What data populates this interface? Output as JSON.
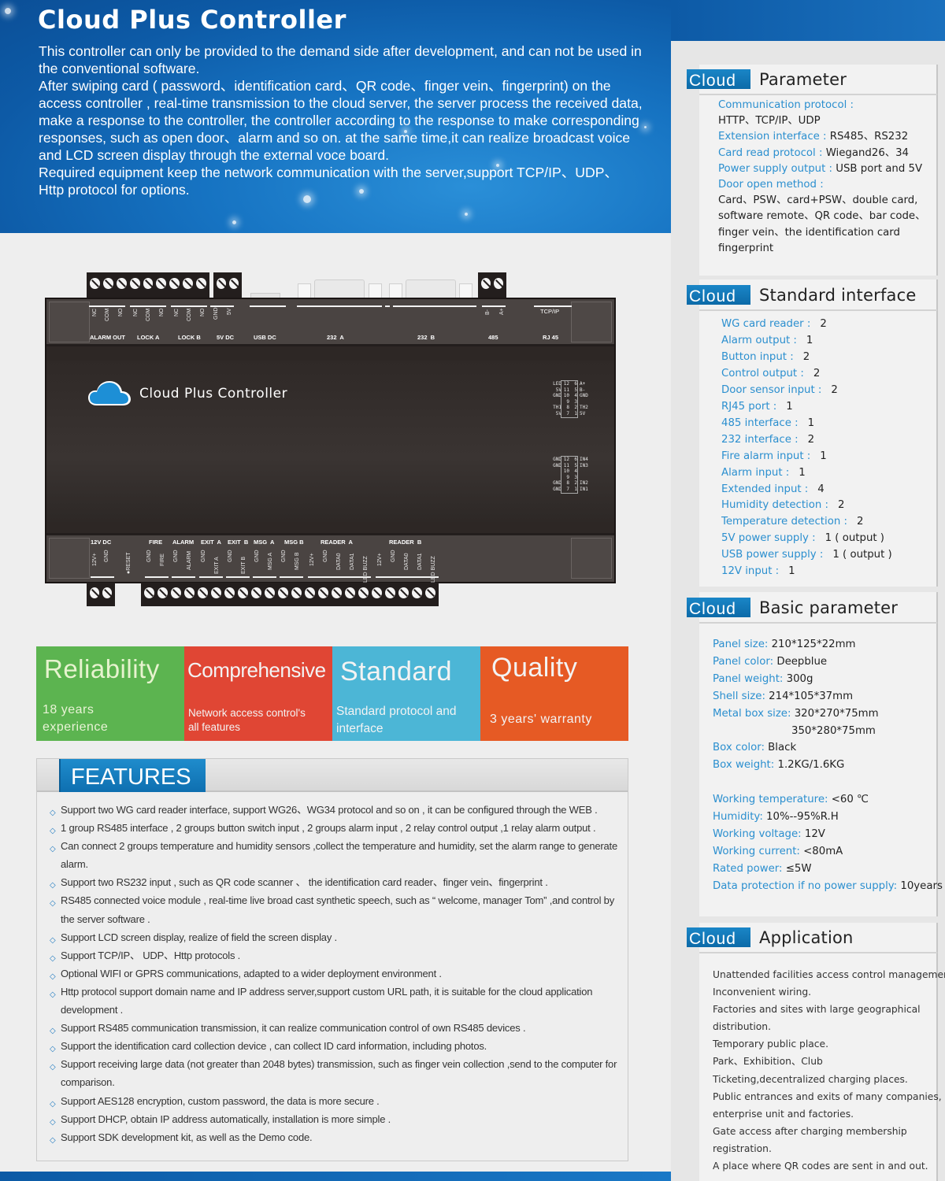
{
  "hero": {
    "title": "Cloud Plus Controller",
    "paragraphs": [
      "This controller can only be provided to the demand side after development, and can not be used in the conventional software.",
      "After swiping card ( password、identification card、QR code、finger vein、fingerprint) on  the  access controller , real-time transmission to the cloud server, the server process the received data,  make a response to the controller, the controller according to the response to make corresponding responses, such as open door、alarm and so on.  at the same time,it can realize broadcast voice and  LCD screen display through the external voce board.",
      "Required equipment  keep the network communication with the server,support  TCP/IP、UDP、 Http protocol for options."
    ]
  },
  "device": {
    "brand": "Cloud Plus Controller",
    "top_groups": [
      {
        "name": "ALARM OUT",
        "pins": [
          "NC",
          "COM",
          "NO"
        ]
      },
      {
        "name": "LOCK A",
        "pins": [
          "NC",
          "COM",
          "NO"
        ]
      },
      {
        "name": "LOCK B",
        "pins": [
          "NC",
          "COM",
          "NO"
        ]
      },
      {
        "name": "5V DC",
        "pins": [
          "GND",
          "5V"
        ]
      },
      {
        "name": "USB DC",
        "pins": []
      },
      {
        "name": "232  A",
        "pins": []
      },
      {
        "name": "232  B",
        "pins": []
      },
      {
        "name": "485",
        "pins": [
          "B-",
          "A+"
        ]
      },
      {
        "name": "RJ 45",
        "pins": [
          "TCP/IP"
        ]
      }
    ],
    "bottom_groups": [
      {
        "name": "12V DC",
        "pins": [
          "12V+",
          "GND"
        ]
      },
      {
        "name": "",
        "pins": [
          "●RESET"
        ]
      },
      {
        "name": "FIRE",
        "pins": [
          "GND",
          "FIRE"
        ]
      },
      {
        "name": "ALARM",
        "pins": [
          "GND",
          "ALARM"
        ]
      },
      {
        "name": "EXIT  A",
        "pins": [
          "GND",
          "EXIT A"
        ]
      },
      {
        "name": "EXIT  B",
        "pins": [
          "GND",
          "EXIT B"
        ]
      },
      {
        "name": "MSG  A",
        "pins": [
          "GND",
          "MSG A"
        ]
      },
      {
        "name": "MSG B",
        "pins": [
          "GND",
          "MSG B"
        ]
      },
      {
        "name": "READER  A",
        "pins": [
          "12V+",
          "GND",
          "DATA0",
          "DATA1",
          "LED BUZZ"
        ]
      },
      {
        "name": "READER  B",
        "pins": [
          "12V+",
          "GND",
          "DATA0",
          "DATA1",
          "LED BUZZ"
        ]
      }
    ],
    "pin_header_1": [
      [
        "LED",
        "12",
        "6",
        "A+"
      ],
      [
        "5V",
        "11",
        "5",
        "B-"
      ],
      [
        "GND",
        "10",
        "4",
        "GND"
      ],
      [
        "",
        "9",
        "3",
        ""
      ],
      [
        "TH1",
        "8",
        "2",
        "TH2"
      ],
      [
        "5V",
        "7",
        "1",
        "5V"
      ]
    ],
    "pin_header_2": [
      [
        "GND",
        "12",
        "6",
        "IN4"
      ],
      [
        "GND",
        "11",
        "5",
        "IN3"
      ],
      [
        "",
        "10",
        "4",
        ""
      ],
      [
        "",
        "9",
        "3",
        ""
      ],
      [
        "GND",
        "8",
        "2",
        "IN2"
      ],
      [
        "GND",
        "7",
        "1",
        "IN1"
      ]
    ]
  },
  "tiles": [
    {
      "title": "Reliability",
      "sub": [
        "18 years",
        "experience"
      ],
      "color": "#5cb450"
    },
    {
      "title": "Comprehensive",
      "sub": [
        "Network access control's",
        "all features"
      ],
      "color": "#e04634"
    },
    {
      "title": "Standard",
      "sub": [
        "Standard protocol and",
        "interface"
      ],
      "color": "#4cb6d6"
    },
    {
      "title": "Quality",
      "sub": [
        "3 years' warranty"
      ],
      "color": "#e65a24"
    }
  ],
  "features": {
    "title": "FEATURES",
    "items": [
      "Support two WG card reader interface, support WG26、WG34 protocol and so on , it can be configured through the WEB .",
      "1 group RS485 interface , 2 groups button switch input , 2 groups alarm input , 2  relay control output ,1  relay alarm output .",
      "Can  connect 2 groups temperature and humidity sensors ,collect the temperature and humidity, set the alarm range to generate alarm.",
      "Support two RS232 input , such as QR code scanner 、 the identification card  reader、finger vein、fingerprint .",
      "RS485 connected voice module , real-time live broad cast synthetic speech, such as “ welcome, manager Tom” ,and control by the server  software .",
      "Support  LCD screen display, realize of field the screen display .",
      "Support  TCP/IP、 UDP、Http  protocols .",
      "Optional WIFI or GPRS communications, adapted to a wider deployment environment .",
      "Http protocol support domain name and IP address server,support custom URL path, it is suitable for the cloud application development .",
      "Support RS485 communication transmission, it can realize communication control of own RS485 devices .",
      "Support the identification card collection device , can collect ID card information, including photos.",
      "Support receiving large data (not greater than 2048 bytes) transmission, such as finger vein collection ,send to the computer for comparison.",
      "Support AES128 encryption, custom password, the data is more secure .",
      "Support DHCP, obtain IP address automatically, installation is more simple .",
      "Support SDK development kit, as well as the Demo code."
    ]
  },
  "right_panel": {
    "tag_label": "Cloud",
    "parameter": {
      "title": "Parameter",
      "lines": [
        {
          "k": "Communication protocol :",
          "v": ""
        },
        {
          "k": "",
          "v": "HTTP、TCP/IP、UDP"
        },
        {
          "k": "Extension interface : ",
          "v": "RS485、RS232"
        },
        {
          "k": "Card read protocol : ",
          "v": "Wiegand26、34"
        },
        {
          "k": "Power supply output : ",
          "v": "USB port and 5V"
        },
        {
          "k": "Door open method :",
          "v": ""
        },
        {
          "k": "",
          "v": "Card、PSW、card+PSW、double card,"
        },
        {
          "k": "",
          "v": "software remote、QR code、bar code、"
        },
        {
          "k": "",
          "v": "finger vein、the identification card"
        },
        {
          "k": "",
          "v": "fingerprint"
        }
      ]
    },
    "standard_interface": {
      "title": "Standard interface",
      "lines": [
        {
          "k": "WG card reader  :",
          "v": "2"
        },
        {
          "k": "Alarm  output :",
          "v": "1"
        },
        {
          "k": "Button   input :",
          "v": "2"
        },
        {
          "k": "Control  output :",
          "v": "2"
        },
        {
          "k": "Door sensor input :",
          "v": "2"
        },
        {
          "k": "RJ45 port :",
          "v": "1"
        },
        {
          "k": "485 interface :",
          "v": "1"
        },
        {
          "k": "232 interface :",
          "v": "2"
        },
        {
          "k": "Fire alarm input :",
          "v": "1"
        },
        {
          "k": "Alarm  input :",
          "v": "1"
        },
        {
          "k": "Extended input :",
          "v": "4"
        },
        {
          "k": "Humidity detection :",
          "v": "2"
        },
        {
          "k": "Temperature  detection :",
          "v": "2"
        },
        {
          "k": "5V power supply :",
          "v": "1 ( output )"
        },
        {
          "k": "USB power supply :",
          "v": "1 ( output )"
        },
        {
          "k": "12V  input :",
          "v": "1"
        }
      ]
    },
    "basic_parameter": {
      "title": "Basic parameter",
      "lines": [
        {
          "k": "Panel size: ",
          "v": "210*125*22mm"
        },
        {
          "k": "Panel color: ",
          "v": "Deepblue"
        },
        {
          "k": "Panel weight: ",
          "v": "300g"
        },
        {
          "k": "Shell size: ",
          "v": "214*105*37mm"
        },
        {
          "k": "Metal box size: ",
          "v": "320*270*75mm"
        },
        {
          "k": "",
          "v": "350*280*75mm"
        },
        {
          "k": "Box color: ",
          "v": "Black"
        },
        {
          "k": "Box weight: ",
          "v": "1.2KG/1.6KG"
        },
        {
          "k": "",
          "v": ""
        },
        {
          "k": "Working temperature: ",
          "v": "<60 ℃"
        },
        {
          "k": "Humidity: ",
          "v": "10%--95%R.H"
        },
        {
          "k": "Working voltage: ",
          "v": "12V"
        },
        {
          "k": "Working current: ",
          "v": "<80mA"
        },
        {
          "k": "Rated power: ",
          "v": "≤5W"
        },
        {
          "k": "Data protection if no power supply: ",
          "v": "10years"
        }
      ]
    },
    "application": {
      "title": "Application",
      "lines": [
        "Unattended facilities access control management.",
        "Inconvenient wiring.",
        "Factories and sites with large geographical",
        "distribution.",
        "Temporary public place.",
        "Park、Exhibition、Club",
        "Ticketing,decentralized charging places.",
        "Public entrances and exits of many companies,",
        "enterprise unit and factories.",
        "Gate access after charging membership",
        "registration.",
        "A place where QR codes are sent in and out."
      ]
    }
  }
}
